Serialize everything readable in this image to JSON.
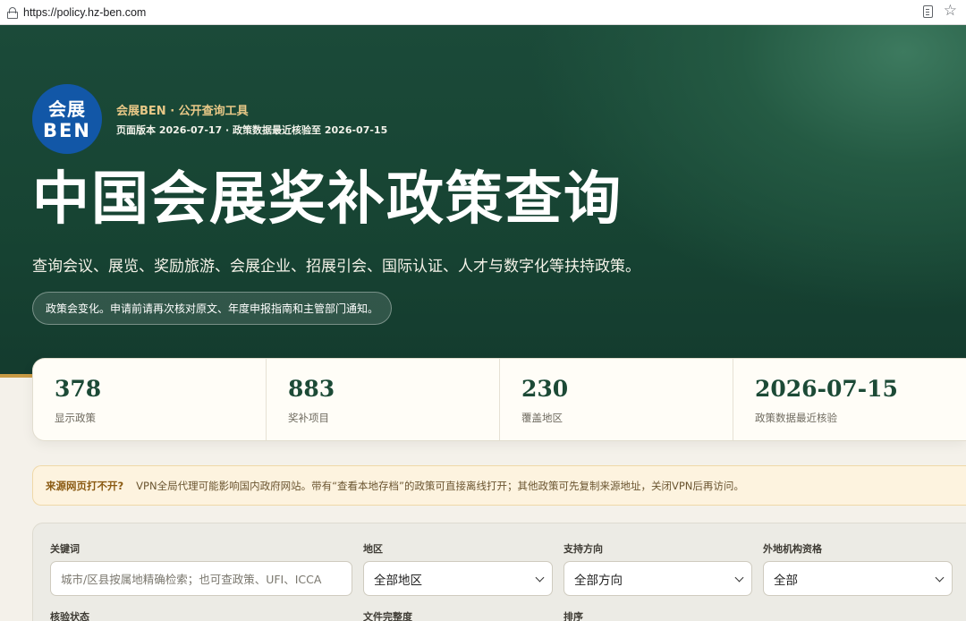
{
  "browser": {
    "url": "https://policy.hz-ben.com"
  },
  "hero": {
    "logo_top": "会展",
    "logo_bottom": "BEN",
    "brand": "会展BEN · 公开查询工具",
    "version": "页面版本 2026-07-17 · 政策数据最近核验至 2026-07-15",
    "title": "中国会展奖补政策查询",
    "subtitle": "查询会议、展览、奖励旅游、会展企业、招展引会、国际认证、人才与数字化等扶持政策。",
    "notice": "政策会变化。申请前请再次核对原文、年度申报指南和主管部门通知。"
  },
  "stats": [
    {
      "value": "378",
      "label": "显示政策"
    },
    {
      "value": "883",
      "label": "奖补项目"
    },
    {
      "value": "230",
      "label": "覆盖地区"
    },
    {
      "value": "2026-07-15",
      "label": "政策数据最近核验"
    }
  ],
  "warning": {
    "title": "来源网页打不开?",
    "text": "VPN全局代理可能影响国内政府网站。带有“查看本地存档”的政策可直接离线打开；其他政策可先复制来源地址，关闭VPN后再访问。"
  },
  "filters": {
    "keyword_label": "关键词",
    "keyword_placeholder": "城市/区县按属地精确检索；也可查政策、UFI、ICCA",
    "region_label": "地区",
    "region_value": "全部地区",
    "direction_label": "支持方向",
    "direction_value": "全部方向",
    "foreign_label": "外地机构资格",
    "foreign_value": "全部",
    "verify_label": "核验状态",
    "completeness_label": "文件完整度",
    "sort_label": "排序"
  },
  "colors": {
    "hero_green": "#174433",
    "accent_gold": "#c89a45",
    "logo_blue": "#1257a7",
    "stat_green": "#1c4a36"
  }
}
